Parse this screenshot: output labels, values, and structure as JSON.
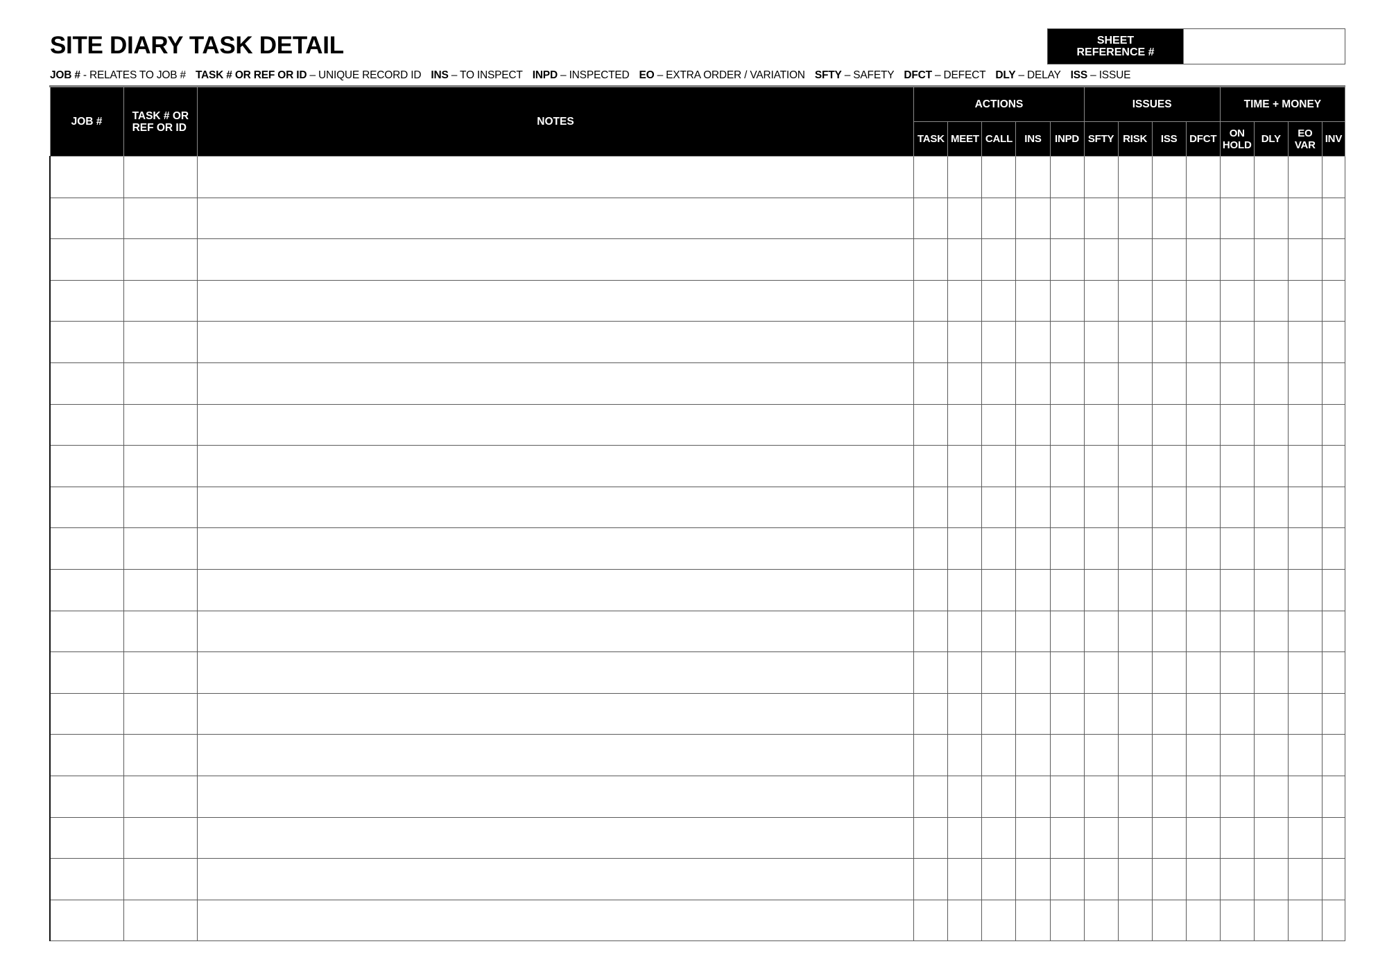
{
  "title": "SITE DIARY TASK DETAIL",
  "sheet_reference": {
    "label_line1": "SHEET",
    "label_line2": "REFERENCE #",
    "value": ""
  },
  "legend": [
    {
      "abbr": "JOB #",
      "sep": " - ",
      "desc": "RELATES TO JOB #"
    },
    {
      "abbr": "TASK # OR REF OR ID",
      "sep": " – ",
      "desc": "UNIQUE RECORD ID"
    },
    {
      "abbr": "INS",
      "sep": " – ",
      "desc": "TO INSPECT"
    },
    {
      "abbr": "INPD",
      "sep": " – ",
      "desc": "INSPECTED"
    },
    {
      "abbr": "EO",
      "sep": " – ",
      "desc": "EXTRA ORDER / VARIATION"
    },
    {
      "abbr": "SFTY",
      "sep": " – ",
      "desc": "SAFETY"
    },
    {
      "abbr": "DFCT",
      "sep": " – ",
      "desc": "DEFECT"
    },
    {
      "abbr": "DLY",
      "sep": " – ",
      "desc": "DELAY"
    },
    {
      "abbr": "ISS",
      "sep": " – ",
      "desc": "ISSUE"
    }
  ],
  "table": {
    "headers": {
      "job": "JOB #",
      "task_line1": "TASK # OR",
      "task_line2": "REF OR ID",
      "notes": "NOTES",
      "groups": {
        "actions": "ACTIONS",
        "issues": "ISSUES",
        "time_money": "TIME + MONEY"
      },
      "actions": [
        "TASK",
        "MEET",
        "CALL",
        "INS",
        "INPD"
      ],
      "issues": [
        "SFTY",
        "RISK",
        "ISS",
        "DFCT"
      ],
      "time_money": [
        {
          "line1": "ON",
          "line2": "HOLD"
        },
        {
          "line1": "DLY",
          "line2": ""
        },
        {
          "line1": "EO",
          "line2": "VAR"
        },
        {
          "line1": "INV",
          "line2": ""
        }
      ]
    },
    "row_count": 19,
    "rows": [
      {
        "job": "",
        "task": "",
        "notes": "",
        "checks": [
          "",
          "",
          "",
          "",
          "",
          "",
          "",
          "",
          "",
          "",
          "",
          "",
          ""
        ]
      }
    ]
  }
}
